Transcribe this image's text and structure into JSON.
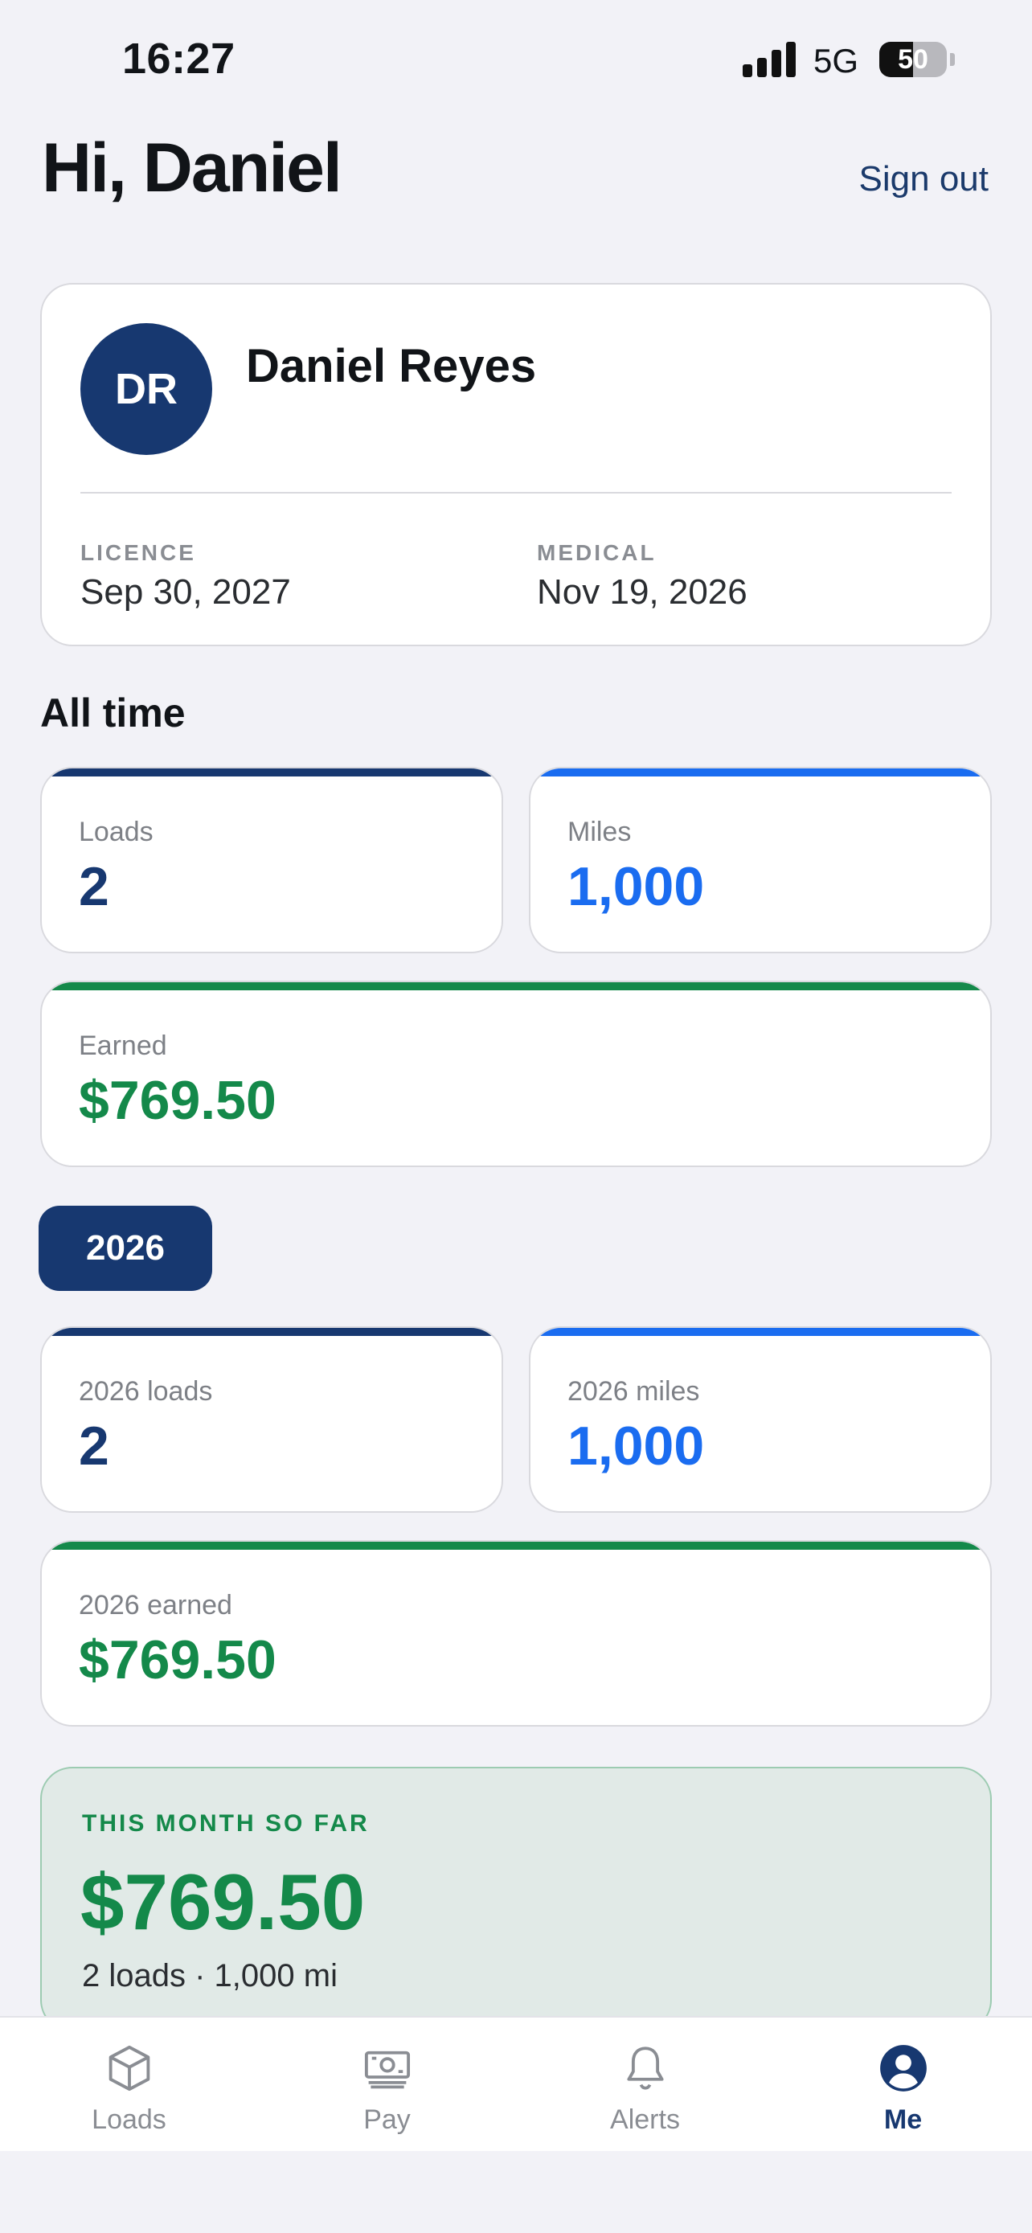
{
  "status": {
    "time": "16:27",
    "network": "5G",
    "battery": "50",
    "battery_level": 0.5
  },
  "header": {
    "greeting": "Hi, Daniel",
    "sign_out": "Sign out"
  },
  "profile": {
    "initials": "DR",
    "name": "Daniel Reyes",
    "licence_label": "LICENCE",
    "licence_value": "Sep 30, 2027",
    "medical_label": "MEDICAL",
    "medical_value": "Nov 19, 2026"
  },
  "all_time": {
    "title": "All time",
    "loads_label": "Loads",
    "loads_value": "2",
    "miles_label": "Miles",
    "miles_value": "1,000",
    "earned_label": "Earned",
    "earned_value": "$769.50"
  },
  "year": {
    "selected": "2026",
    "loads_label": "2026 loads",
    "loads_value": "2",
    "miles_label": "2026 miles",
    "miles_value": "1,000",
    "earned_label": "2026 earned",
    "earned_value": "$769.50"
  },
  "month": {
    "label": "THIS MONTH SO FAR",
    "amount": "$769.50",
    "summary": "2 loads · 1,000 mi"
  },
  "tabs": [
    {
      "label": "Loads",
      "icon": "box-icon"
    },
    {
      "label": "Pay",
      "icon": "banknote-icon"
    },
    {
      "label": "Alerts",
      "icon": "bell-icon"
    },
    {
      "label": "Me",
      "icon": "person-icon",
      "active": true
    }
  ],
  "colors": {
    "navy": "#173870",
    "blue": "#1a6cf0",
    "green": "#14894a"
  }
}
